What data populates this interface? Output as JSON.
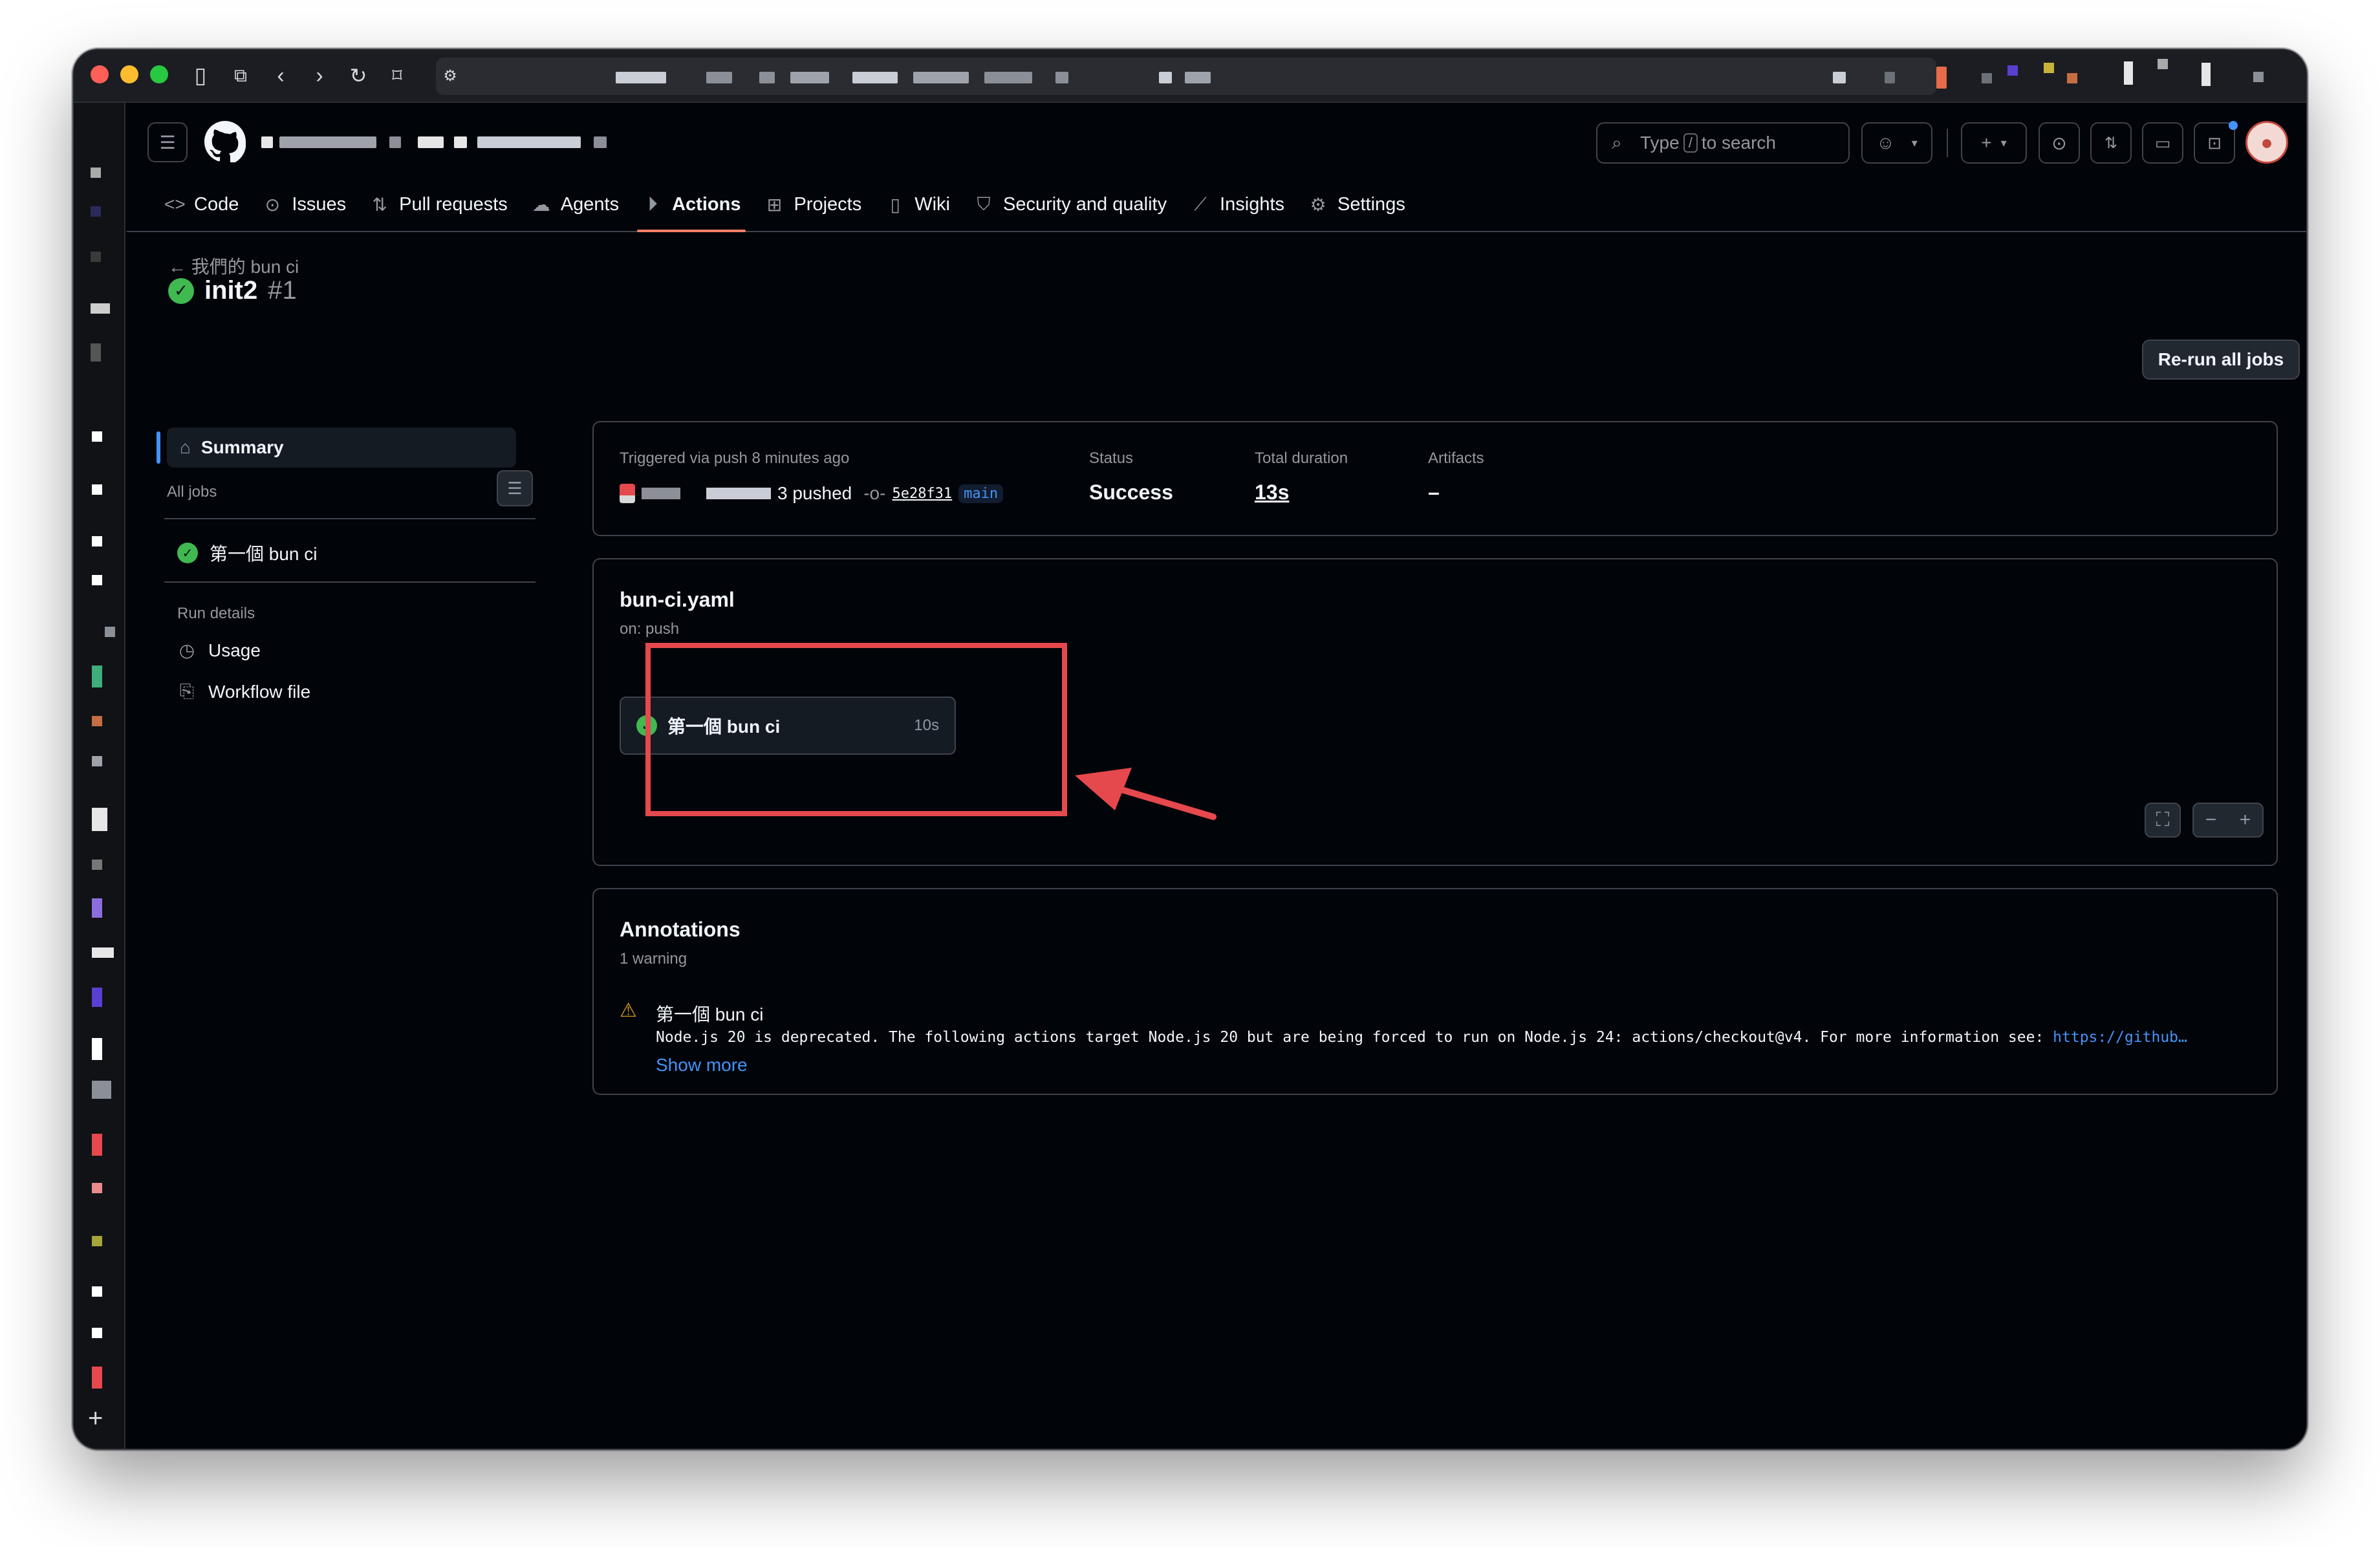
{
  "repo_nav": {
    "search_before": "Type",
    "search_key": "/",
    "search_after": "to search",
    "tabs": [
      {
        "label": "Code",
        "icon": "code-icon"
      },
      {
        "label": "Issues",
        "icon": "issue-icon"
      },
      {
        "label": "Pull requests",
        "icon": "pull-request-icon"
      },
      {
        "label": "Agents",
        "icon": "agent-icon"
      },
      {
        "label": "Actions",
        "icon": "play-icon",
        "active": true
      },
      {
        "label": "Projects",
        "icon": "table-icon"
      },
      {
        "label": "Wiki",
        "icon": "book-icon"
      },
      {
        "label": "Security and quality",
        "icon": "shield-icon"
      },
      {
        "label": "Insights",
        "icon": "graph-icon"
      },
      {
        "label": "Settings",
        "icon": "gear-icon"
      }
    ]
  },
  "run": {
    "workflow_back": "我們的 bun ci",
    "title": "init2",
    "number": "#1",
    "rerun_label": "Re-run all jobs"
  },
  "sidebar": {
    "summary": "Summary",
    "all_jobs": "All jobs",
    "job": "第一個 bun ci",
    "run_details": "Run details",
    "usage": "Usage",
    "workflow_file": "Workflow file"
  },
  "summary": {
    "triggered": "Triggered via push 8 minutes ago",
    "pushed_suffix": "3 pushed",
    "commit": "5e28f31",
    "branch": "main",
    "status_label": "Status",
    "status_value": "Success",
    "duration_label": "Total duration",
    "duration_value": "13s",
    "artifacts_label": "Artifacts",
    "artifacts_value": "–"
  },
  "workflow": {
    "file": "bun-ci.yaml",
    "trigger": "on: push",
    "job_name": "第一個 bun ci",
    "job_duration": "10s"
  },
  "annotations": {
    "title": "Annotations",
    "count": "1 warning",
    "job": "第一個 bun ci",
    "message": "Node.js 20 is deprecated. The following actions target Node.js 20 but are being forced to run on Node.js 24: actions/checkout@v4. For more information see:",
    "link": "https://github…",
    "show_more": "Show more"
  },
  "colors": {
    "success": "#3fb950",
    "accent": "#4493f8",
    "tab_underline": "#f78166",
    "highlight_box": "#e5484d",
    "background": "#010409"
  }
}
